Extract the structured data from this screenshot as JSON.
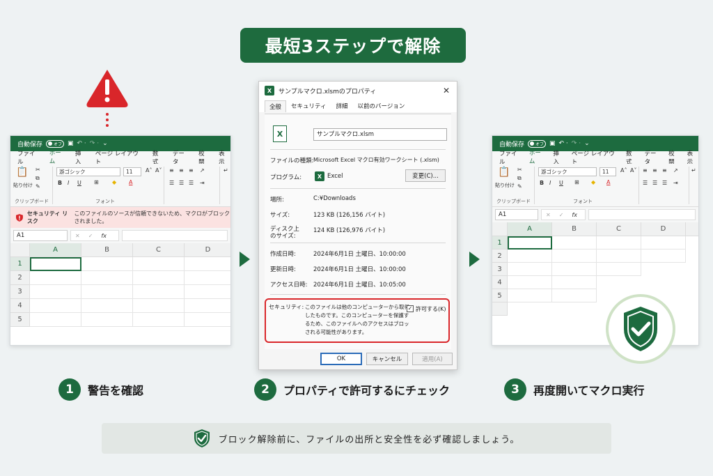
{
  "banner": {
    "title": "最短3ステップで解除"
  },
  "left_window": {
    "autosave_label": "自動保存",
    "autosave_state": "オフ",
    "menu": [
      "ファイル",
      "ホーム",
      "挿入",
      "ページ レイアウト",
      "数式",
      "データ",
      "校閲",
      "表示"
    ],
    "active_menu": "ホーム",
    "font_name": "游ゴシック",
    "font_size": "11",
    "paste_label": "貼り付け",
    "clipboard_label": "クリップボード",
    "font_group_label": "フォント",
    "security_title": "セキュリティ リスク",
    "security_message": "このファイルのソースが信頼できないため、マクロがブロックされました。",
    "name_box": "A1",
    "fx": "fx",
    "columns": [
      "A",
      "B",
      "C",
      "D"
    ],
    "rows": [
      "1",
      "2",
      "3",
      "4",
      "5"
    ]
  },
  "dialog": {
    "title": "サンプルマクロ.xlsmのプロパティ",
    "tabs": [
      "全般",
      "セキュリティ",
      "詳細",
      "以前のバージョン"
    ],
    "active_tab": "全般",
    "filename": "サンプルマクロ.xlsm",
    "type_label": "ファイルの種類:",
    "type_value": "Microsoft Excel マクロ有効ワークシート (.xlsm)",
    "program_label": "プログラム:",
    "program_value": "Excel",
    "change_button": "変更(C)...",
    "location_label": "場所:",
    "location_value": "C:¥Downloads",
    "size_label": "サイズ:",
    "size_value": "123 KB (126,156 バイト)",
    "disk_size_label_1": "ディスク上",
    "disk_size_label_2": "のサイズ:",
    "disk_size_value": "124 KB (126,976 バイト)",
    "created_label": "作成日時:",
    "created_value": "2024年6月1日 土曜日、10:00:00",
    "modified_label": "更新日時:",
    "modified_value": "2024年6月1日 土曜日、10:00:00",
    "accessed_label": "アクセス日時:",
    "accessed_value": "2024年6月1日 土曜日、10:05:00",
    "security_label": "セキュリティ:",
    "security_text_1": "このファイルは他のコンピューターから取得",
    "security_text_2": "したものです。このコンピューターを保護す",
    "security_text_3": "るため、このファイルへのアクセスはブロッ",
    "security_text_4": "される可能性があります。",
    "allow_label": "許可する(K)",
    "allow_checked": true,
    "ok_button": "OK",
    "cancel_button": "キャンセル",
    "apply_button": "適用(A)"
  },
  "right_window": {
    "autosave_label": "自動保存",
    "autosave_state": "オフ",
    "menu": [
      "ファイル",
      "ホーム",
      "挿入",
      "ページ レイアウト",
      "数式",
      "データ",
      "校閲",
      "表示"
    ],
    "font_name": "游ゴシック",
    "font_size": "11",
    "paste_label": "貼り付け",
    "clipboard_label": "クリップボード",
    "font_group_label": "フォント",
    "name_box": "A1",
    "fx": "fx",
    "columns": [
      "A",
      "B",
      "C",
      "D"
    ],
    "rows": [
      "1",
      "2",
      "3",
      "4",
      "5"
    ]
  },
  "steps": [
    {
      "num": "1",
      "label": "警告を確認"
    },
    {
      "num": "2",
      "label": "プロパティで許可するにチェック"
    },
    {
      "num": "3",
      "label": "再度開いてマクロ実行"
    }
  ],
  "notice": "ブロック解除前に、ファイルの出所と安全性を必ず確認しましょう。",
  "colors": {
    "brand_green": "#1d6b3f",
    "warning_red": "#d9262a",
    "warning_bar": "#fbe2e1"
  }
}
